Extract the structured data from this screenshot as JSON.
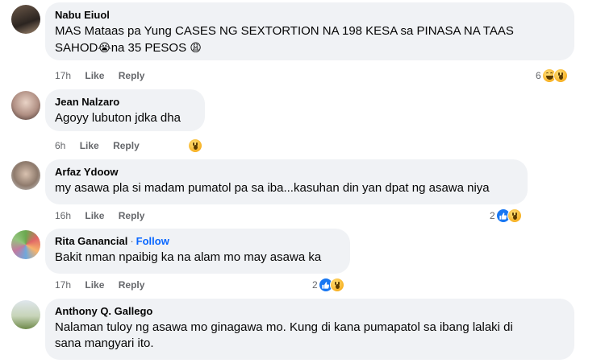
{
  "comments": [
    {
      "author": "Nabu Eiuol",
      "text_line1": "MAS Mataas pa Yung CASES NG SEXTORTION NA 198 KESA sa PINASA NA TAAS",
      "text_line2a": "SAHOD",
      "emoji1": "😭",
      "text_line2b": "na 35 PESOS",
      "emoji2": "😩",
      "time": "17h",
      "like_label": "Like",
      "reply_label": "Reply",
      "reaction_count": "6",
      "reactions": [
        "haha-icon",
        "wow-icon"
      ]
    },
    {
      "author": "Jean Nalzaro",
      "text": "Agoyy lubuton jdka dha",
      "time": "6h",
      "like_label": "Like",
      "reply_label": "Reply",
      "reaction_count": "",
      "reactions": [
        "wow-icon"
      ]
    },
    {
      "author": "Arfaz Ydoow",
      "text": "my asawa pla si madam pumatol pa sa iba...kasuhan din yan dpat ng asawa niya",
      "time": "16h",
      "like_label": "Like",
      "reply_label": "Reply",
      "reaction_count": "2",
      "reactions": [
        "like-icon",
        "wow-icon"
      ]
    },
    {
      "author": "Rita Ganancial",
      "follow_label": "Follow",
      "text": "Bakit nman npaibig ka na alam mo may asawa ka",
      "time": "17h",
      "like_label": "Like",
      "reply_label": "Reply",
      "reaction_count": "2",
      "reactions": [
        "like-icon",
        "wow-icon"
      ]
    },
    {
      "author": "Anthony Q. Gallego",
      "text_line1": "Nalaman tuloy ng asawa mo ginagawa mo. Kung di kana pumapatol sa ibang lalaki di",
      "text_line2": "sana mangyari ito."
    }
  ],
  "colors": {
    "bubble": "#f0f2f5",
    "meta": "#65676b",
    "link": "#0866ff",
    "like": "#1877f2"
  }
}
